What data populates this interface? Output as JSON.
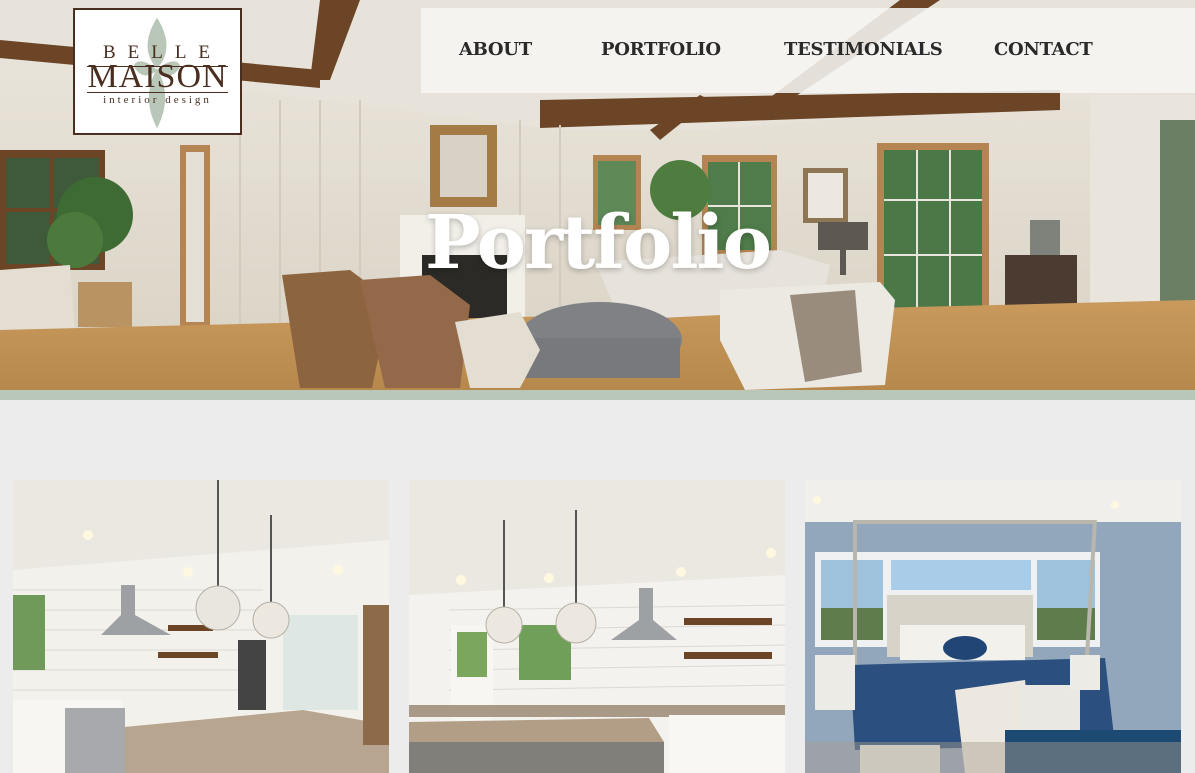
{
  "brand": {
    "line1": "BELLE",
    "line2": "MAISON",
    "line3": "interior design"
  },
  "nav": {
    "items": [
      {
        "label": "ABOUT"
      },
      {
        "label": "PORTFOLIO"
      },
      {
        "label": "TESTIMONIALS"
      },
      {
        "label": "CONTACT"
      }
    ]
  },
  "hero": {
    "title": "Portfolio"
  },
  "gallery": {
    "items": [
      {
        "subject": "kitchen-with-pendant-lights"
      },
      {
        "subject": "kitchen-with-floating-shelves"
      },
      {
        "subject": "bedroom-with-canopy-bed"
      }
    ]
  },
  "colors": {
    "brand_brown": "#4a2e20",
    "accent_sage": "#b9c7b8",
    "page_bg": "#ececec"
  }
}
